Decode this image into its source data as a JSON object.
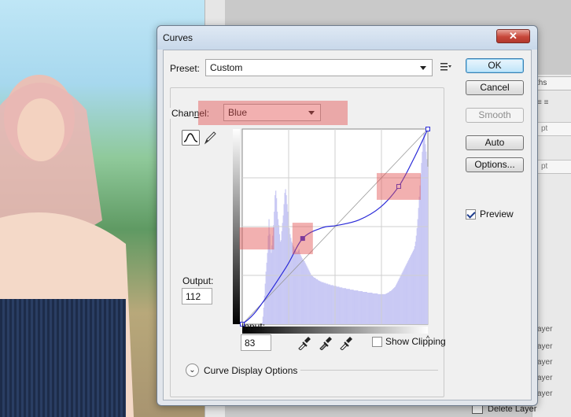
{
  "dialog": {
    "title": "Curves",
    "preset_label": "Preset:",
    "preset_value": "Custom",
    "channel_label_prefix": "Chan",
    "channel_label_underlined": "n",
    "channel_label_suffix": "el:",
    "channel_value": "Blue",
    "output_label": "Output:",
    "output_value": "112",
    "input_label": "Input:",
    "input_value": "83",
    "show_clipping_label": "Show Clipping",
    "show_clipping_checked": false,
    "curve_display_options_label": "Curve Display Options",
    "buttons": {
      "ok": "OK",
      "cancel": "Cancel",
      "smooth": "Smooth",
      "auto": "Auto",
      "options": "Options..."
    },
    "preview_label": "Preview",
    "preview_checked": true
  },
  "background_panel": {
    "tab_label": "ths",
    "field_1": "pt",
    "field_2": "pt",
    "layer_rows": [
      "ayer",
      "ayer",
      "ayer",
      "ayer",
      "ayer"
    ],
    "delete_layer_label": "Delete Layer"
  },
  "chart_data": {
    "type": "line",
    "title": "",
    "xlabel": "Input",
    "ylabel": "Output",
    "xlim": [
      0,
      255
    ],
    "ylim": [
      0,
      255
    ],
    "grid": true,
    "series": [
      {
        "name": "Blue",
        "x": [
          0,
          20,
          60,
          83,
          110,
          130,
          160,
          190,
          215,
          235,
          255
        ],
        "y": [
          0,
          18,
          74,
          112,
          126,
          129,
          136,
          153,
          180,
          215,
          255
        ]
      }
    ],
    "control_points": {
      "x": [
        0,
        83,
        215,
        255
      ],
      "y": [
        0,
        112,
        180,
        255
      ]
    },
    "histogram": [
      0,
      0,
      0,
      0,
      0,
      0,
      0,
      0,
      0,
      0,
      0,
      0,
      0,
      0,
      0,
      0,
      0,
      0,
      0,
      0,
      0,
      0,
      0,
      0,
      0,
      0,
      2,
      10,
      22,
      38,
      54,
      70,
      82,
      95,
      118,
      140,
      120,
      100,
      95,
      105,
      118,
      132,
      150,
      172,
      178,
      168,
      150,
      140,
      132,
      120,
      110,
      112,
      124,
      135,
      145,
      160,
      175,
      180,
      172,
      160,
      150,
      140,
      128,
      120,
      115,
      110,
      108,
      105,
      103,
      100,
      98,
      97,
      95,
      96,
      98,
      100,
      95,
      92,
      90,
      88,
      86,
      85,
      84,
      82,
      80,
      78,
      76,
      74,
      72,
      70,
      68,
      66,
      65,
      64,
      63,
      62,
      62,
      61,
      60,
      60,
      59,
      58,
      58,
      57,
      57,
      56,
      56,
      56,
      55,
      55,
      55,
      54,
      54,
      54,
      53,
      53,
      53,
      52,
      52,
      52,
      52,
      51,
      51,
      51,
      51,
      50,
      50,
      50,
      50,
      49,
      49,
      49,
      49,
      48,
      48,
      48,
      48,
      48,
      47,
      47,
      47,
      47,
      47,
      46,
      46,
      46,
      46,
      46,
      45,
      45,
      45,
      45,
      45,
      45,
      44,
      44,
      44,
      44,
      44,
      44,
      43,
      43,
      43,
      43,
      43,
      43,
      42,
      42,
      42,
      42,
      42,
      42,
      42,
      41,
      41,
      41,
      41,
      41,
      41,
      41,
      40,
      40,
      40,
      40,
      40,
      40,
      40,
      40,
      40,
      40,
      40,
      41,
      41,
      42,
      42,
      43,
      44,
      44,
      45,
      46,
      47,
      48,
      49,
      50,
      52,
      54,
      56,
      58,
      60,
      62,
      64,
      66,
      68,
      70,
      72,
      74,
      76,
      78,
      80,
      82,
      84,
      86,
      88,
      90,
      92,
      94,
      96,
      98,
      100,
      104,
      110,
      118,
      128,
      140,
      155,
      170,
      185,
      200,
      215,
      230,
      245,
      255,
      255,
      240,
      230,
      220,
      210
    ],
    "colors": {
      "curve": "#2a2ad8",
      "histogram": "#c9c9f4",
      "grid": "#cfcfcf",
      "diagonal": "#9a9a9a",
      "highlight": "#e25050"
    }
  }
}
